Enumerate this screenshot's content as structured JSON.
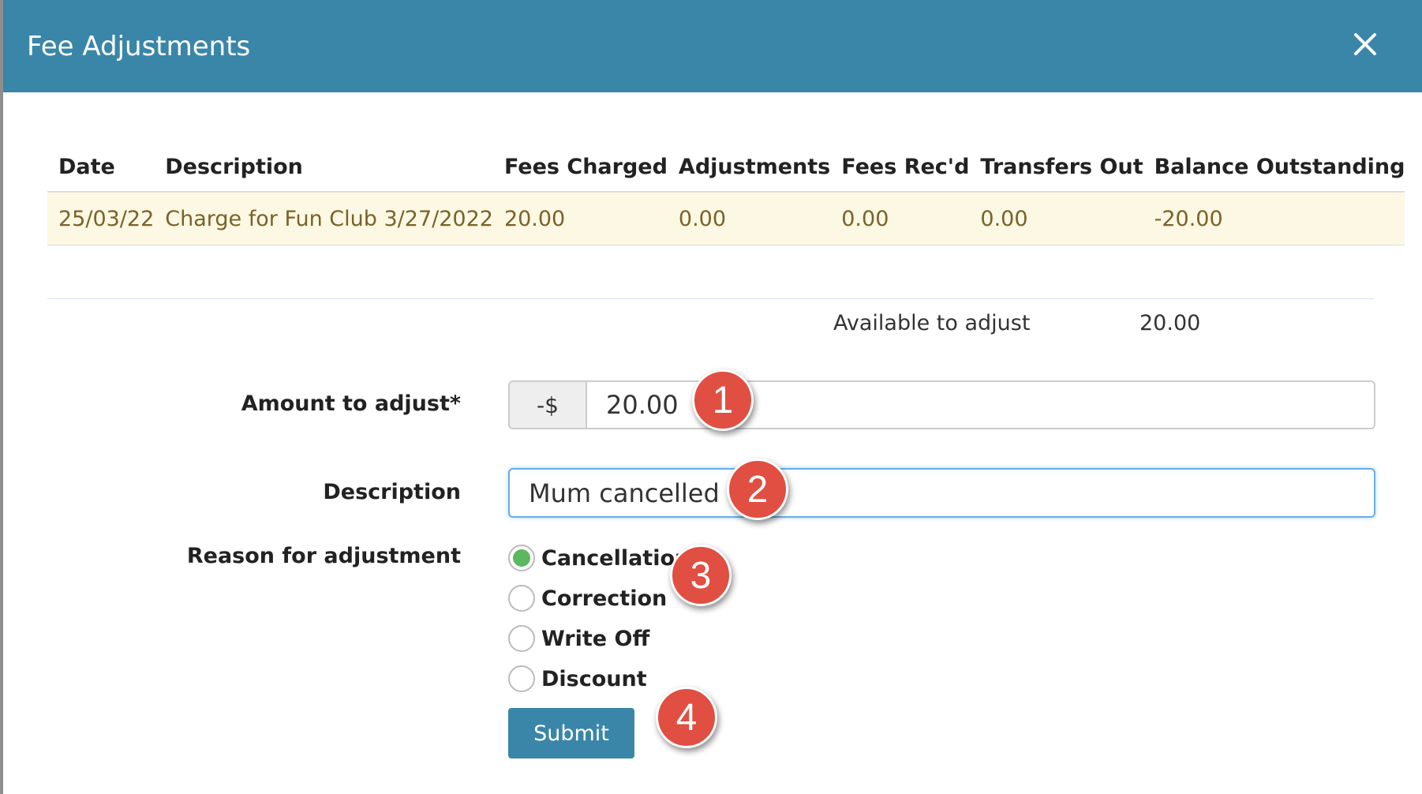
{
  "modal": {
    "title": "Fee Adjustments",
    "close_icon": "close-icon"
  },
  "table": {
    "headers": [
      "Date",
      "Description",
      "Fees Charged",
      "Adjustments",
      "Fees Rec'd",
      "Transfers Out",
      "Balance Outstanding"
    ],
    "rows": [
      [
        "25/03/22",
        "Charge for Fun Club 3/27/2022",
        "20.00",
        "0.00",
        "0.00",
        "0.00",
        "-20.00"
      ]
    ]
  },
  "available": {
    "label": "Available to adjust",
    "value": "20.00"
  },
  "form": {
    "amount_label": "Amount to adjust*",
    "amount_prefix": "-$",
    "amount_value": "20.00",
    "description_label": "Description",
    "description_value": "Mum cancelled",
    "reason_label": "Reason for adjustment",
    "reasons": [
      "Cancellation",
      "Correction",
      "Write Off",
      "Discount"
    ],
    "selected_reason": "Cancellation",
    "submit_label": "Submit"
  },
  "markers": [
    "1",
    "2",
    "3",
    "4"
  ],
  "colors": {
    "header_bg": "#3a86a9",
    "row_highlight": "#fcf8e3",
    "selected_radio": "#5cb85c",
    "marker": "#e04f42",
    "submit_bg": "#3a86a9"
  }
}
